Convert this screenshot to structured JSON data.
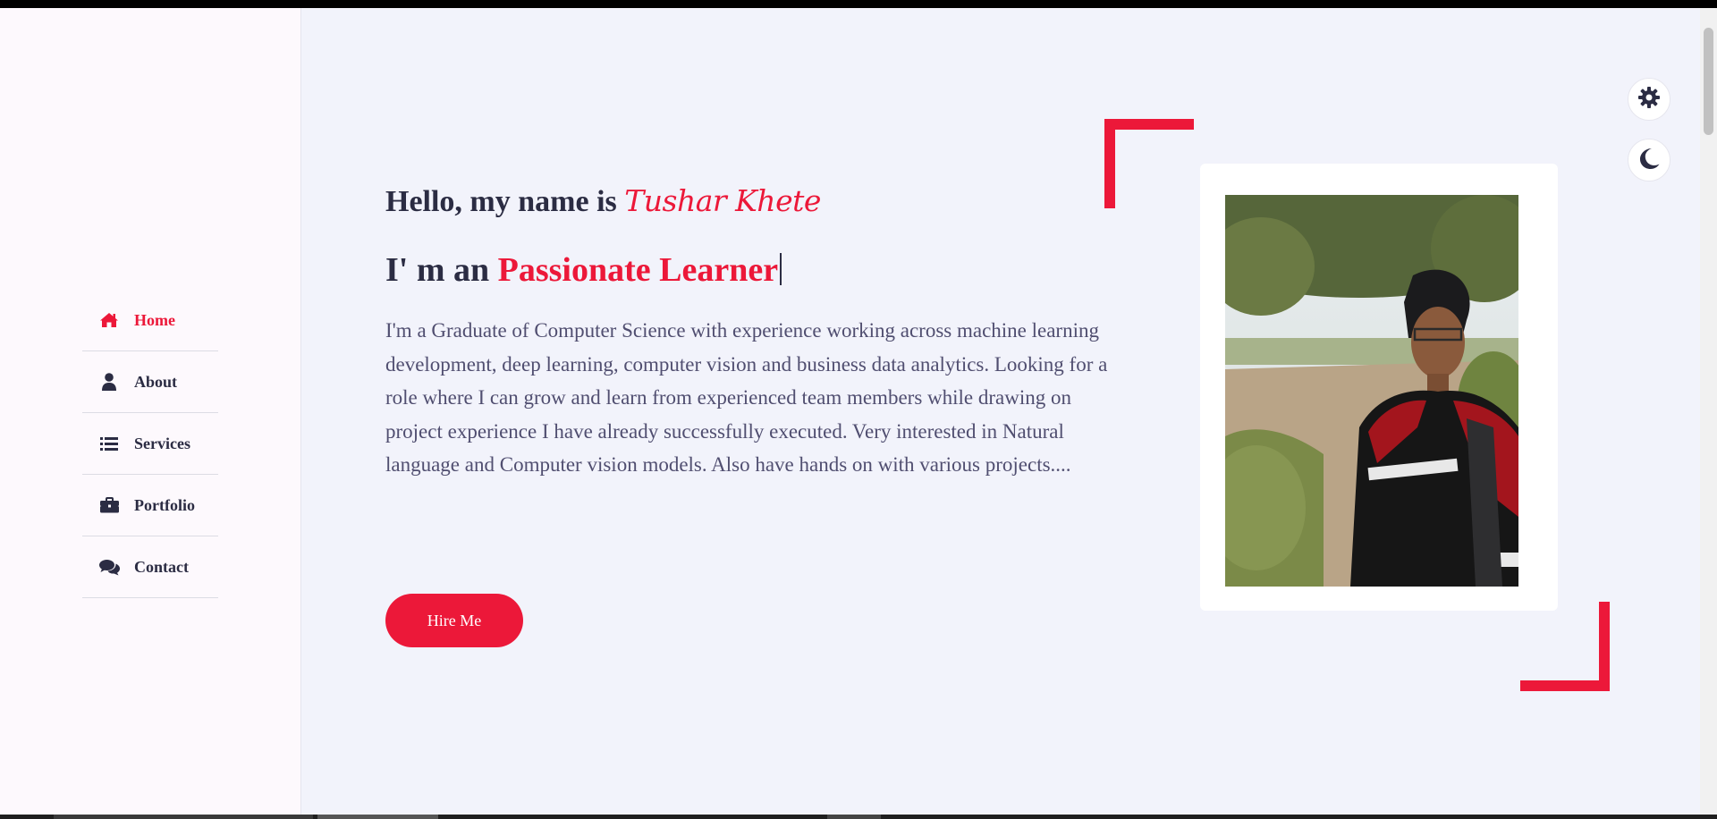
{
  "nav": {
    "items": [
      {
        "label": "Home",
        "icon": "home-icon",
        "active": true
      },
      {
        "label": "About",
        "icon": "user-icon",
        "active": false
      },
      {
        "label": "Services",
        "icon": "list-icon",
        "active": false
      },
      {
        "label": "Portfolio",
        "icon": "briefcase-icon",
        "active": false
      },
      {
        "label": "Contact",
        "icon": "comments-icon",
        "active": false
      }
    ]
  },
  "tools": {
    "settings_icon": "gear-icon",
    "theme_icon": "moon-icon"
  },
  "hero": {
    "greeting": "Hello, my name is",
    "name": "Tushar Khete",
    "role_prefix": "I' m an",
    "role_typed": "Passionate Learner",
    "bio": "I'm a Graduate of Computer Science with experience working across machine learning development, deep learning, computer vision and business data analytics. Looking for a role where I can grow and learn from experienced team members while drawing on project experience I have already successfully executed. Very interested in Natural language and Computer vision models. Also have hands on with various projects....",
    "cta_label": "Hire Me"
  },
  "colors": {
    "accent": "#ec1839",
    "text_dark": "#2b2c43",
    "text_body": "#504e70",
    "background": "#f2f3fb",
    "sidebar": "#fdf9fd"
  }
}
